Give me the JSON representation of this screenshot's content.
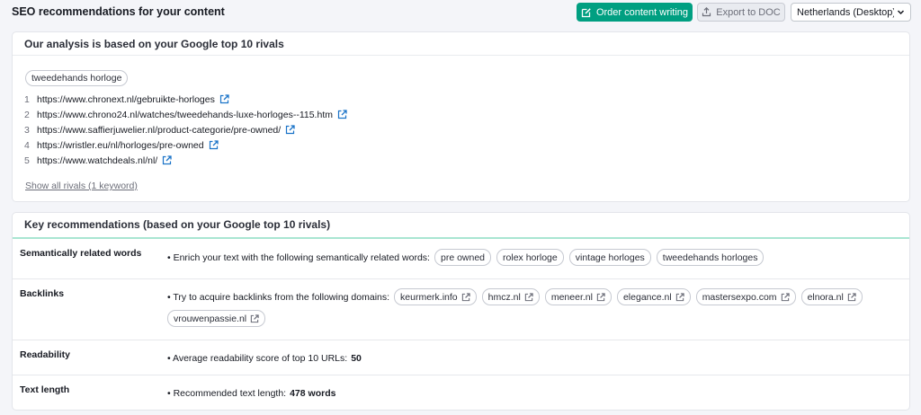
{
  "header": {
    "title": "SEO recommendations for your content",
    "order_label": "Order content writing",
    "export_label": "Export to DOC",
    "database_selected": "Netherlands (Desktop)"
  },
  "analysis": {
    "title": "Our analysis is based on your Google top 10 rivals",
    "keyword": "tweedehands horloge",
    "rivals": [
      {
        "num": "1",
        "url": "https://www.chronext.nl/gebruikte-horloges"
      },
      {
        "num": "2",
        "url": "https://www.chrono24.nl/watches/tweedehands-luxe-horloges--115.htm"
      },
      {
        "num": "3",
        "url": "https://www.saffierjuwelier.nl/product-categorie/pre-owned/"
      },
      {
        "num": "4",
        "url": "https://wristler.eu/nl/horloges/pre-owned"
      },
      {
        "num": "5",
        "url": "https://www.watchdeals.nl/nl/"
      }
    ],
    "show_all_label": "Show all rivals (1 keyword)"
  },
  "recommendations": {
    "title": "Key recommendations (based on your Google top 10 rivals)",
    "semantic": {
      "label": "Semantically related words",
      "text": "• Enrich your text with the following semantically related words:",
      "words": [
        "pre owned",
        "rolex horloge",
        "vintage horloges",
        "tweedehands horloges"
      ]
    },
    "backlinks": {
      "label": "Backlinks",
      "text": "• Try to acquire backlinks from the following domains:",
      "domains": [
        "keurmerk.info",
        "hmcz.nl",
        "meneer.nl",
        "elegance.nl",
        "mastersexpo.com",
        "elnora.nl",
        "vrouwenpassie.nl"
      ]
    },
    "readability": {
      "label": "Readability",
      "text": "• Average readability score of top 10 URLs:",
      "value": "50"
    },
    "text_length": {
      "label": "Text length",
      "text": "• Recommended text length:",
      "value": "478 words"
    }
  },
  "colors": {
    "accent": "#009f81",
    "link_icon": "#1a73c8"
  },
  "icons": {
    "order": "edit-icon",
    "export": "export-icon",
    "dropdown": "chevron-down-icon",
    "external": "external-link-icon"
  }
}
